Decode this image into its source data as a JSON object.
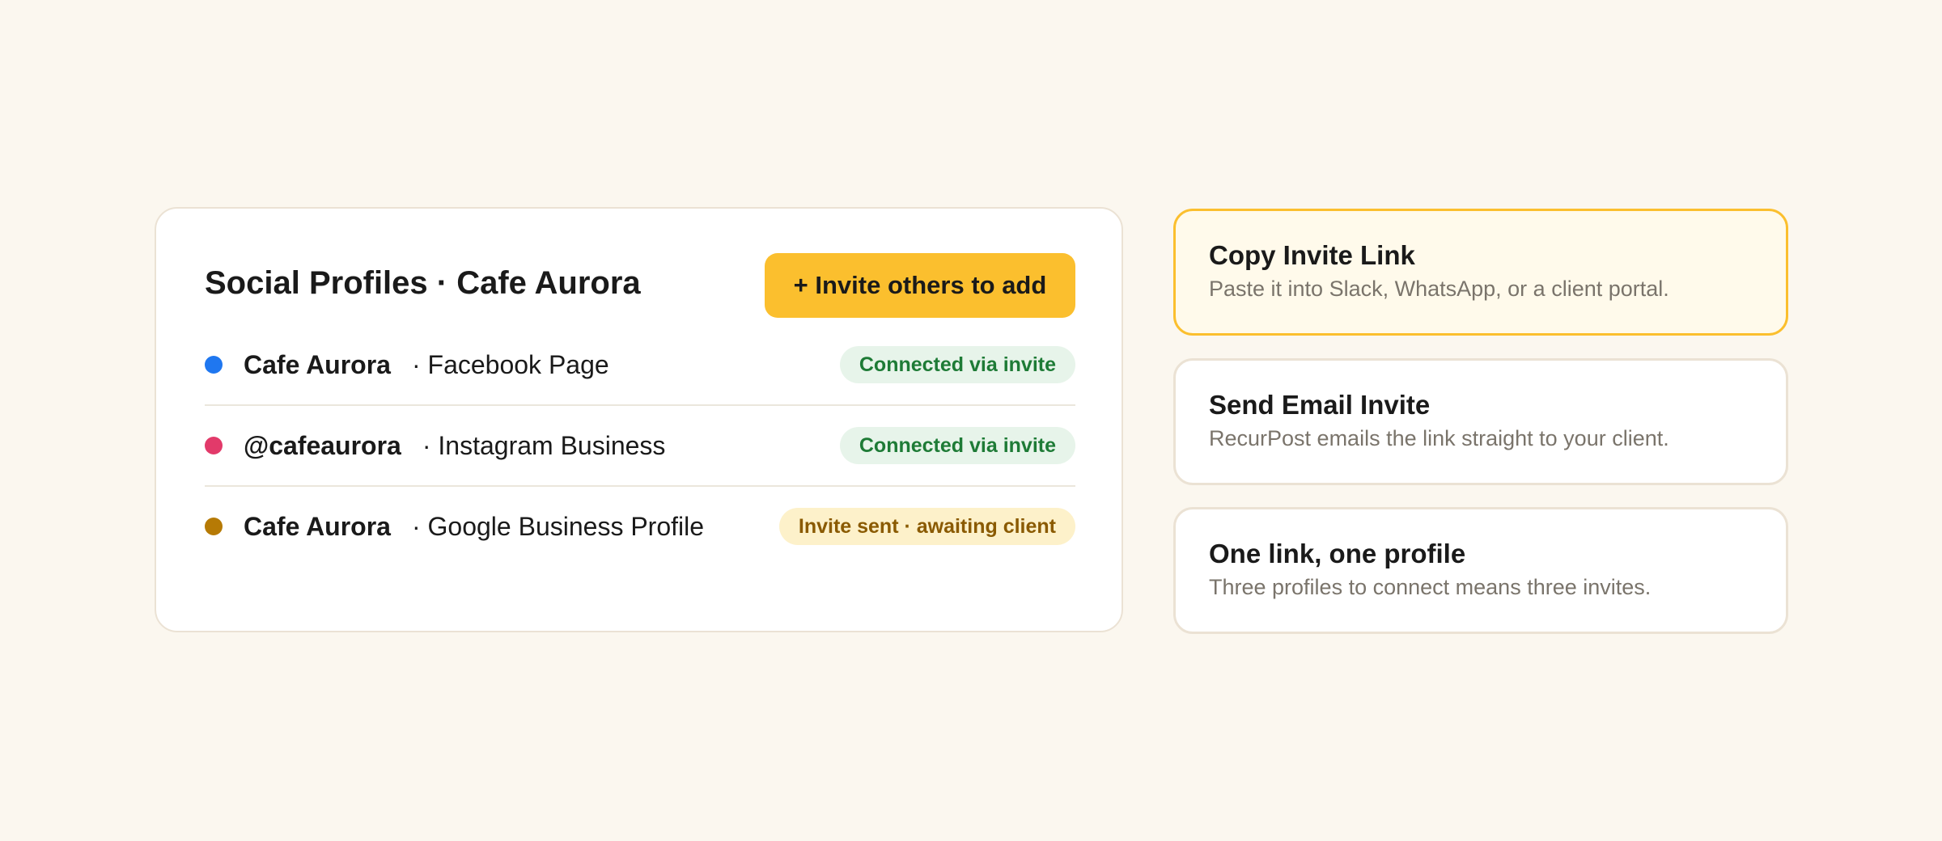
{
  "card": {
    "title": "Social Profiles · Cafe Aurora",
    "invite_button_label": "+ Invite others to add"
  },
  "profiles": [
    {
      "name": "Cafe Aurora",
      "type": "· Facebook Page",
      "status": "Connected via invite",
      "status_kind": "connected",
      "dot_color": "#1f77f0"
    },
    {
      "name": "@cafeaurora",
      "type": "· Instagram Business",
      "status": "Connected via invite",
      "status_kind": "connected",
      "dot_color": "#e23a6a"
    },
    {
      "name": "Cafe Aurora",
      "type": "· Google Business Profile",
      "status": "Invite sent · awaiting client",
      "status_kind": "pending",
      "dot_color": "#b67a05"
    }
  ],
  "options": [
    {
      "title": "Copy Invite Link",
      "description": "Paste it into Slack, WhatsApp, or a client portal.",
      "highlighted": true
    },
    {
      "title": "Send Email Invite",
      "description": "RecurPost emails the link straight to your client.",
      "highlighted": false
    },
    {
      "title": "One link, one profile",
      "description": "Three profiles to connect means three invites.",
      "highlighted": false
    }
  ],
  "colors": {
    "accent": "#fbbf2e",
    "background": "#fbf7ef",
    "connected_badge_bg": "#e7f4ea",
    "connected_badge_text": "#1e7b36",
    "pending_badge_bg": "#fdf1ca",
    "pending_badge_text": "#8a5a00"
  }
}
